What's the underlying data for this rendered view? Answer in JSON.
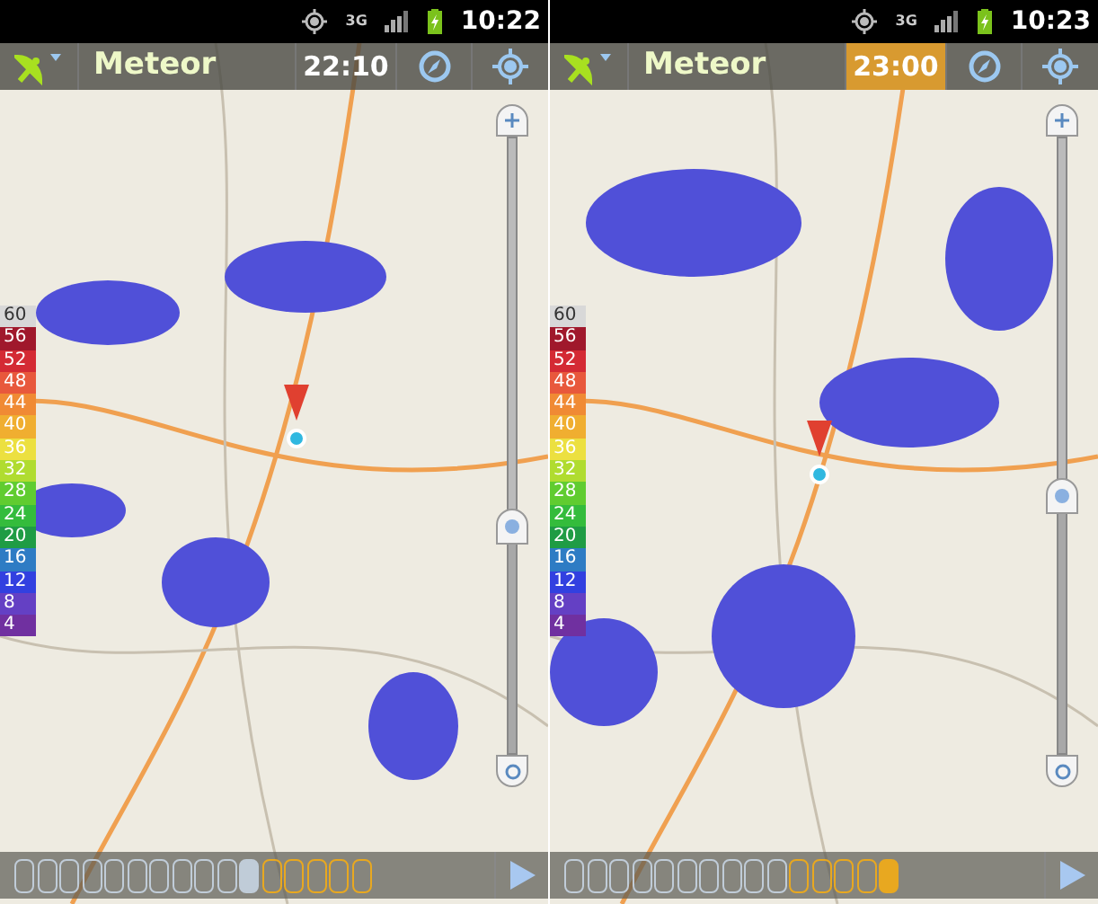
{
  "phones": [
    {
      "status_bar": {
        "network": "3G",
        "time": "10:22"
      },
      "app_bar": {
        "title": "Meteor",
        "time": "22:10",
        "time_highlighted": false
      },
      "zoom": {
        "level": 0.37
      },
      "legend": [
        {
          "label": "60",
          "color": "#d8d8d8"
        },
        {
          "label": "56",
          "color": "#a0182c"
        },
        {
          "label": "52",
          "color": "#d42a34"
        },
        {
          "label": "48",
          "color": "#e8583c"
        },
        {
          "label": "44",
          "color": "#f08a34"
        },
        {
          "label": "40",
          "color": "#f0ae30"
        },
        {
          "label": "36",
          "color": "#ece040"
        },
        {
          "label": "32",
          "color": "#b0dc30"
        },
        {
          "label": "28",
          "color": "#60cc30"
        },
        {
          "label": "24",
          "color": "#34bc3c"
        },
        {
          "label": "20",
          "color": "#1f9c44"
        },
        {
          "label": "16",
          "color": "#2e7cc4"
        },
        {
          "label": "12",
          "color": "#3240e0"
        },
        {
          "label": "8",
          "color": "#6440c4"
        },
        {
          "label": "4",
          "color": "#7030a0"
        }
      ],
      "timeline": [
        {
          "kind": "past",
          "selected": false
        },
        {
          "kind": "past",
          "selected": false
        },
        {
          "kind": "past",
          "selected": false
        },
        {
          "kind": "past",
          "selected": false
        },
        {
          "kind": "past",
          "selected": false
        },
        {
          "kind": "past",
          "selected": false
        },
        {
          "kind": "past",
          "selected": false
        },
        {
          "kind": "past",
          "selected": false
        },
        {
          "kind": "past",
          "selected": false
        },
        {
          "kind": "past",
          "selected": false
        },
        {
          "kind": "past",
          "selected": true
        },
        {
          "kind": "future",
          "selected": false
        },
        {
          "kind": "future",
          "selected": false
        },
        {
          "kind": "future",
          "selected": false
        },
        {
          "kind": "future",
          "selected": false
        },
        {
          "kind": "future",
          "selected": false
        }
      ]
    },
    {
      "status_bar": {
        "network": "3G",
        "time": "10:23"
      },
      "app_bar": {
        "title": "Meteor",
        "time": "23:00",
        "time_highlighted": true
      },
      "zoom": {
        "level": 0.42
      },
      "legend": [
        {
          "label": "60",
          "color": "#d8d8d8"
        },
        {
          "label": "56",
          "color": "#a0182c"
        },
        {
          "label": "52",
          "color": "#d42a34"
        },
        {
          "label": "48",
          "color": "#e8583c"
        },
        {
          "label": "44",
          "color": "#f08a34"
        },
        {
          "label": "40",
          "color": "#f0ae30"
        },
        {
          "label": "36",
          "color": "#ece040"
        },
        {
          "label": "32",
          "color": "#b0dc30"
        },
        {
          "label": "28",
          "color": "#60cc30"
        },
        {
          "label": "24",
          "color": "#34bc3c"
        },
        {
          "label": "20",
          "color": "#1f9c44"
        },
        {
          "label": "16",
          "color": "#2e7cc4"
        },
        {
          "label": "12",
          "color": "#3240e0"
        },
        {
          "label": "8",
          "color": "#6440c4"
        },
        {
          "label": "4",
          "color": "#7030a0"
        }
      ],
      "timeline": [
        {
          "kind": "past",
          "selected": false
        },
        {
          "kind": "past",
          "selected": false
        },
        {
          "kind": "past",
          "selected": false
        },
        {
          "kind": "past",
          "selected": false
        },
        {
          "kind": "past",
          "selected": false
        },
        {
          "kind": "past",
          "selected": false
        },
        {
          "kind": "past",
          "selected": false
        },
        {
          "kind": "past",
          "selected": false
        },
        {
          "kind": "past",
          "selected": false
        },
        {
          "kind": "past",
          "selected": false
        },
        {
          "kind": "future",
          "selected": false
        },
        {
          "kind": "future",
          "selected": false
        },
        {
          "kind": "future",
          "selected": false
        },
        {
          "kind": "future",
          "selected": false
        },
        {
          "kind": "future",
          "selected": true
        }
      ]
    }
  ]
}
